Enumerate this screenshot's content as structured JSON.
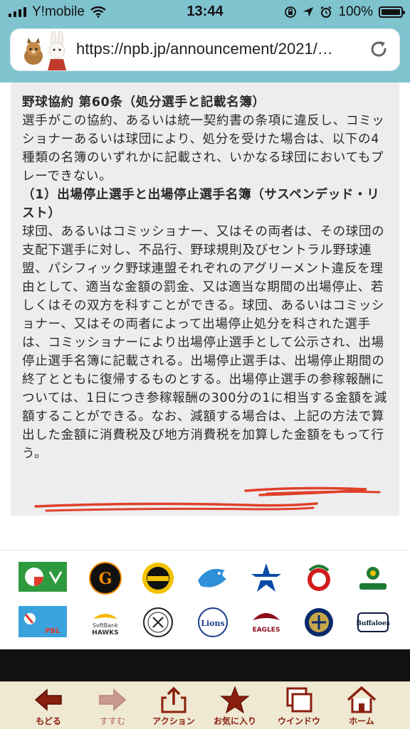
{
  "status_bar": {
    "carrier": "Y!mobile",
    "time": "13:44",
    "battery": "100%"
  },
  "url_bar": {
    "url": "https://npb.jp/announcement/2021/…"
  },
  "article": {
    "title": "野球協約 第60条（処分選手と記載名簿）",
    "paragraph1": "選手がこの協約、あるいは統一契約書の条項に違反し、コミッショナーあるいは球団により、処分を受けた場合は、以下の4種類の名簿のいずれかに記載され、いかなる球団においてもプレーできない。",
    "subtitle": "（1）出場停止選手と出場停止選手名簿（サスペンデッド・リスト）",
    "paragraph2": "球団、あるいはコミッショナー、又はその両者は、その球団の支配下選手に対し、不品行、野球規則及びセントラル野球連盟、パシフィック野球連盟それぞれのアグリーメント違反を理由として、適当な金額の罰金、又は適当な期間の出場停止、若しくはその双方を科すことができる。球団、あるいはコミッショナー、又はその両者によって出場停止処分を科された選手は、コミッショナーにより出場停止選手として公示され、出場停止選手名簿に記載される。出場停止選手は、出場停止期間の終了とともに復帰するものとする。出場停止選手の参稼報酬については、1日につき参稼報酬の300分の1に相当する金額を減額することができる。なお、減額する場合は、上記の方法で算出した金額に消費税及び地方消費税を加算した金額をもって行う。"
  },
  "logos": {
    "row1": [
      {
        "name": "Central League",
        "icon": "central-league-logo",
        "color": "#2e9a3e"
      },
      {
        "name": "Giants",
        "icon": "giants-logo",
        "color": "#f08a00"
      },
      {
        "name": "Tigers",
        "icon": "tigers-logo",
        "color": "#f2c200"
      },
      {
        "name": "Dragons",
        "icon": "dragons-logo",
        "color": "#2f8fd8"
      },
      {
        "name": "BayStars",
        "icon": "baystars-logo",
        "color": "#0a4aa8"
      },
      {
        "name": "Carp",
        "icon": "carp-logo",
        "color": "#d01c1c"
      },
      {
        "name": "Swallows",
        "icon": "swallows-logo",
        "color": "#1f7a33"
      }
    ],
    "row2": [
      {
        "name": "Pacific League",
        "icon": "pacific-league-logo",
        "color": "#3aa3de",
        "text": "PBL"
      },
      {
        "name": "SoftBank Hawks",
        "icon": "hawks-logo",
        "color": "#f6b800",
        "text": "SoftBank HAWKS"
      },
      {
        "name": "Marines",
        "icon": "marines-logo",
        "color": "#222222"
      },
      {
        "name": "Lions",
        "icon": "lions-logo",
        "color": "#1b3d8c",
        "text": "Lions"
      },
      {
        "name": "Eagles",
        "icon": "eagles-logo",
        "color": "#8b0c1c",
        "text": "EAGLES"
      },
      {
        "name": "Fighters",
        "icon": "fighters-logo",
        "color": "#0a2a6b"
      },
      {
        "name": "Buffaloes",
        "icon": "buffaloes-logo",
        "color": "#0d1b3e",
        "text": "Buffaloes"
      }
    ]
  },
  "toolbar": {
    "items": [
      {
        "label": "もどる",
        "icon": "back-arrow-icon",
        "enabled": true
      },
      {
        "label": "すすむ",
        "icon": "forward-arrow-icon",
        "enabled": false
      },
      {
        "label": "アクション",
        "icon": "share-icon",
        "enabled": true
      },
      {
        "label": "お気に入り",
        "icon": "star-icon",
        "enabled": true
      },
      {
        "label": "ウインドウ",
        "icon": "windows-icon",
        "enabled": true
      },
      {
        "label": "ホーム",
        "icon": "home-icon",
        "enabled": true
      }
    ]
  },
  "colors": {
    "header_bg": "#7fc3cf",
    "content_bg": "#ededf0",
    "toolbar_bg": "#efe8d2",
    "toolbar_accent": "#8a1f0e",
    "scribble": "#e0402a"
  }
}
